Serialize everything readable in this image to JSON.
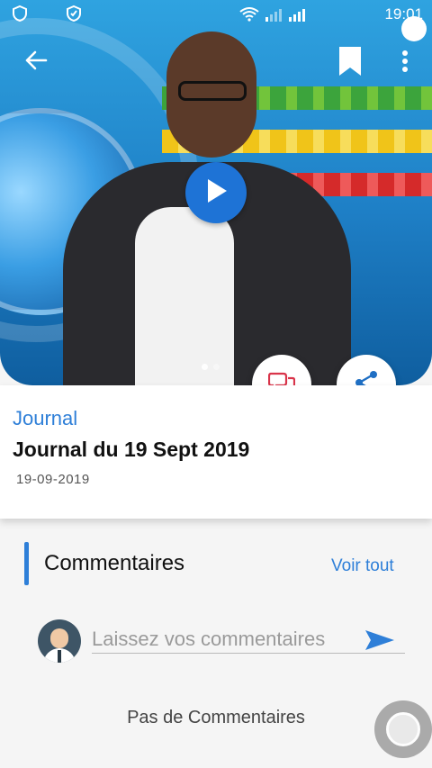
{
  "status_bar": {
    "time": "19:01",
    "left_icons": [
      "shield-icon",
      "shield-check-icon"
    ],
    "right_icons": [
      "wifi-icon",
      "signal-icon",
      "signal-icon"
    ]
  },
  "video": {
    "play_icon": "play-icon",
    "page_indicator_count": 2,
    "page_indicator_active": 1
  },
  "toolbar": {
    "back_icon": "arrow-left-icon",
    "bookmark_icon": "bookmark-icon",
    "more_icon": "more-vertical-icon"
  },
  "actions": {
    "comment_icon": "comments-icon",
    "share_icon": "share-icon"
  },
  "article": {
    "category": "Journal",
    "title": "Journal du 19 Sept 2019",
    "date": "19-09-2019"
  },
  "comments": {
    "heading": "Commentaires",
    "see_all": "Voir tout",
    "input_placeholder": "Laissez vos commentaires",
    "empty_text": "Pas de Commentaires"
  },
  "colors": {
    "accent": "#2e7fd8",
    "play": "#1e73d6",
    "comment_icon": "#d9344a",
    "share_icon": "#1f6fc4"
  }
}
